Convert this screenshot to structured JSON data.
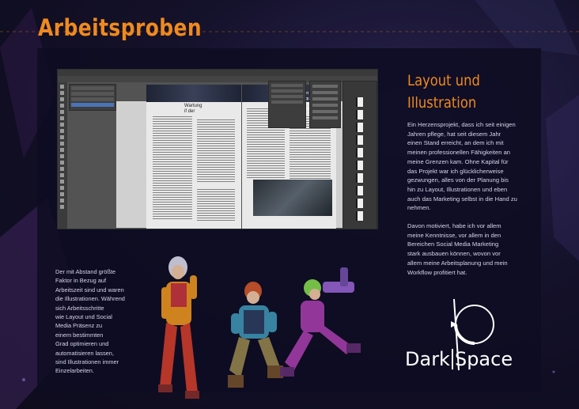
{
  "page": {
    "title": "Arbeitsproben"
  },
  "section": {
    "heading_line1": "Layout und",
    "heading_line2": "Illustration",
    "paragraph1": "Ein Herzensprojekt, dass ich seit einigen\nJahren pflege, hat seit diesem Jahr\neinen Stand erreicht, an dem ich mit\nmeinen professionellen Fähigkeiten an\nmeine Grenzen kam. Ohne Kapital für\ndas Projekt war ich glücklicherweise\ngezwungen, alles von der Planung bis\nhin zu Layout, Illustrationen und eben\nauch das Marketing selbst in die Hand zu\nnehmen.",
    "paragraph2": "Davon motiviert, habe ich vor allem\nmeine Kenntnisse, vor allem in den\nBereichen Social Media Marketing\nstark ausbauen können, wovon vor\nallem meine Arbeitsplanung und mein\nWorkflow profitiert hat."
  },
  "side_note": {
    "text": "Der mit Abstand größte\nFaktor in Bezug auf\nArbeitszeit sind und waren\ndie Illustrationen. Während\nsich Arbeitsschritte\nwie Layout und Social\nMedia Präsenz zu\neinem bestimmten\nGrad optimieren und\nautomatisieren lassen,\nsind Illustrationen immer\nEinzelarbeiten."
  },
  "screenshot": {
    "left_page_heading": "Wartung\nif der",
    "right_page_heading": "Sektion 8:\nWohnquartie\n„Die Siedlung\nÜberlebende"
  },
  "logo": {
    "word_left": "Dark",
    "word_right": "Space"
  },
  "colors": {
    "accent": "#f08a1e",
    "background": "#14112a",
    "panel": "#0e0c22",
    "text": "#d6d2ea"
  }
}
